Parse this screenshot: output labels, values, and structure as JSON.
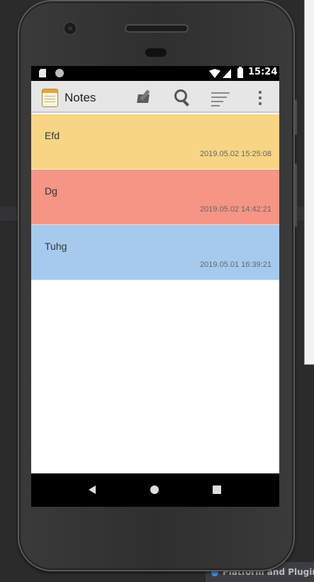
{
  "app": {
    "title": "Notes",
    "icon": "notepad-icon"
  },
  "status_bar": {
    "time": "15:24",
    "icons": [
      "sd-card-icon",
      "circle-icon",
      "wifi-icon",
      "signal-icon",
      "battery-icon"
    ]
  },
  "toolbar": {
    "actions": [
      "edit-note-icon",
      "search-icon",
      "sort-icon",
      "more-vert-icon"
    ]
  },
  "notes": [
    {
      "title": "Efd",
      "timestamp": "2019.05.02 15:25:08",
      "color": "#f7d584"
    },
    {
      "title": "Dg",
      "timestamp": "2019.05.02 14:42:21",
      "color": "#f59585"
    },
    {
      "title": "Tuhg",
      "timestamp": "2019.05.01 16:39:21",
      "color": "#a6caee"
    }
  ],
  "nav_bar": {
    "buttons": [
      "back-icon",
      "home-icon",
      "recents-icon"
    ]
  },
  "ide": {
    "status_text": "Platform and Plugin"
  }
}
